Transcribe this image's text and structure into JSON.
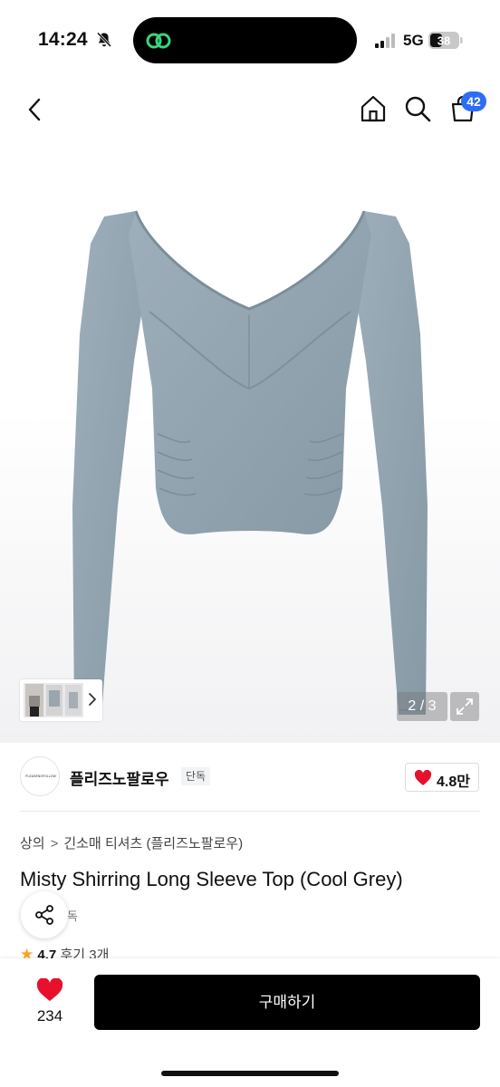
{
  "status_bar": {
    "time": "14:24",
    "network": "5G",
    "battery": "38",
    "icons": [
      "bell-slash-icon",
      "app-link-icon",
      "signal-icon",
      "battery-icon"
    ]
  },
  "nav": {
    "icons": [
      "back-chevron-icon",
      "home-icon",
      "search-icon",
      "cart-icon"
    ],
    "cart_count": "42"
  },
  "gallery": {
    "counter": "2 / 3",
    "icons": [
      "thumbnail-chevron-icon",
      "expand-icon"
    ],
    "garment_color": "#8fa0ab"
  },
  "brand": {
    "logo_text": "PLEASENOFOLLOW",
    "name": "플리즈노팔로우",
    "tag": "단독",
    "likes": "4.8만"
  },
  "product": {
    "breadcrumb": [
      "상의",
      "긴소매 티셔츠 (플리즈노팔로우)"
    ],
    "breadcrumb_separator": ">",
    "title": "Misty Shirring Long Sleeve Top (Cool Grey)",
    "exclusive_tag": "단독",
    "rating": "4.7",
    "reviews": "후기 3개"
  },
  "bottom_bar": {
    "wish_count": "234",
    "buy_label": "구매하기"
  },
  "colors": {
    "accent_blue": "#2d6df6",
    "heart_red": "#e8112d",
    "star": "#f5a623",
    "button_black": "#000000"
  }
}
